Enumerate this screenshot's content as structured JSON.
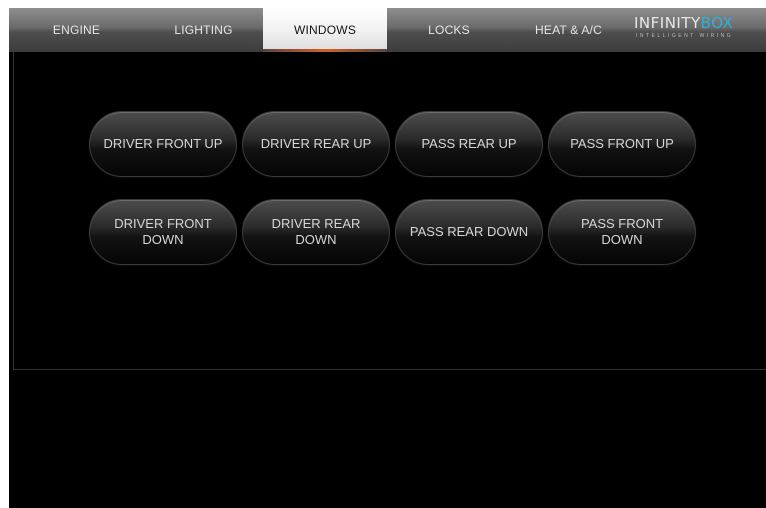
{
  "tabs": [
    {
      "label": "ENGINE",
      "active": false
    },
    {
      "label": "LIGHTING",
      "active": false
    },
    {
      "label": "WINDOWS",
      "active": true
    },
    {
      "label": "LOCKS",
      "active": false
    },
    {
      "label": "HEAT & A/C",
      "active": false
    }
  ],
  "logo": {
    "main": "INFINITY",
    "accent": "BOX",
    "tagline": "INTELLIGENT WIRING"
  },
  "window_buttons": {
    "up": [
      "DRIVER FRONT UP",
      "DRIVER REAR UP",
      "PASS REAR UP",
      "PASS FRONT UP"
    ],
    "down": [
      "DRIVER FRONT DOWN",
      "DRIVER REAR DOWN",
      "PASS REAR DOWN",
      "PASS FRONT DOWN"
    ]
  },
  "colors": {
    "active_tab_underline": "#d0622a",
    "logo_accent": "#2fb0d8",
    "background": "#000000"
  }
}
